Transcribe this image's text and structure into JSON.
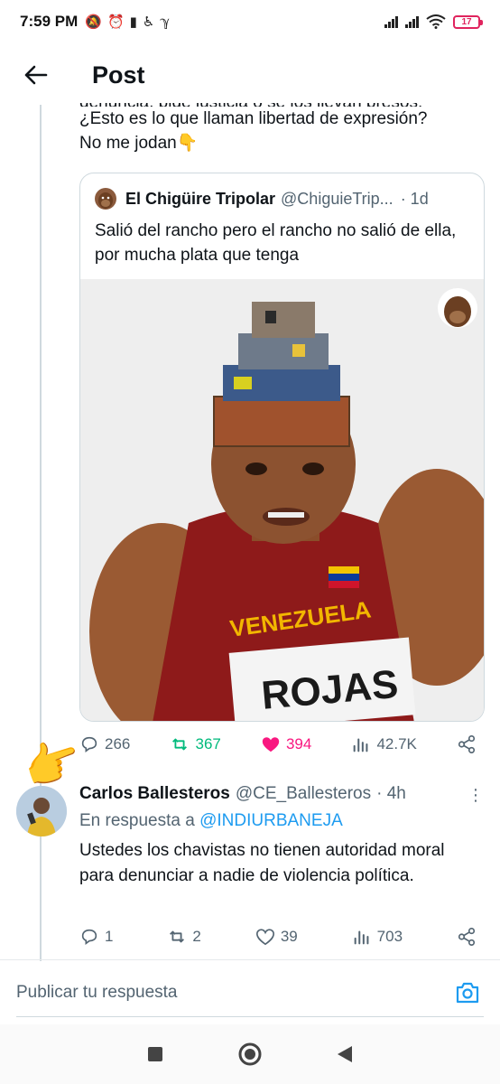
{
  "status_bar": {
    "time": "7:59 PM",
    "icons": [
      "notifications-off-icon",
      "alarm-icon",
      "sim-icon",
      "accessibility-icon",
      "app-icon"
    ],
    "battery": "17"
  },
  "header": {
    "title": "Post",
    "back_icon": "arrow-left-icon"
  },
  "previous_tweet": {
    "clipped_text": "denuncia, pide justicia o se los llevan presos.",
    "text_line1": "¿Esto es lo que llaman libertad de expresión?",
    "text_line2": "No me jodan👇"
  },
  "quote": {
    "name": "El Chigüire Tripolar",
    "handle": "@ChiguieTrip...",
    "time": "· 1d",
    "text": "Salió del rancho pero el rancho no salió de ella, por mucha plata que tenga",
    "image_text": {
      "shirt": "VENEZUELA",
      "bib": "ROJAS"
    }
  },
  "main_actions": {
    "replies": "266",
    "retweets": "367",
    "likes": "394",
    "views": "42.7K",
    "colors": {
      "retweet": "#00ba7c",
      "like": "#f91880",
      "neutral": "#536471"
    }
  },
  "reply": {
    "name": "Carlos Ballesteros",
    "handle": "@CE_Ballesteros",
    "time": "· 4h",
    "reply_prefix": "En respuesta a",
    "reply_to": "@INDIURBANEJA",
    "text": "Ustedes los chavistas no tienen autoridad moral para denunciar a nadie de violencia política.",
    "actions": {
      "replies": "1",
      "retweets": "2",
      "likes": "39",
      "views": "703"
    }
  },
  "composer": {
    "placeholder": "Publicar tu respuesta"
  },
  "pointer_emoji": "👉"
}
